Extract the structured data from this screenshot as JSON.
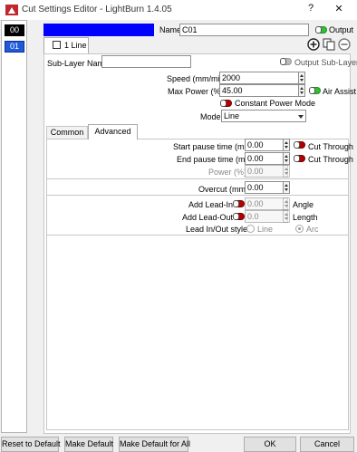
{
  "window": {
    "title": "Cut Settings Editor - LightBurn 1.4.05",
    "help_glyph": "?",
    "close_glyph": "✕"
  },
  "layers": [
    "00",
    "01"
  ],
  "layer_colors": {
    "00": "#000000",
    "01": "#1f59d6",
    "swatch": "#0000ff"
  },
  "header": {
    "name_label": "Name",
    "name_value": "C01",
    "output_label": "Output"
  },
  "sublayer": {
    "tab_label": "1 Line",
    "name_label": "Sub-Layer Name",
    "name_value": "",
    "output_label": "Output Sub-Layer",
    "icons": [
      "add-circle-icon",
      "copy-icon",
      "remove-circle-icon"
    ]
  },
  "settings": {
    "speed_label": "Speed (mm/min)",
    "speed_value": "2000",
    "max_power_label": "Max Power (%)",
    "max_power_value": "45.00",
    "air_assist_label": "Air Assist",
    "constant_power_label": "Constant Power Mode",
    "mode_label": "Mode",
    "mode_value": "Line"
  },
  "tabs": {
    "common": "Common",
    "advanced": "Advanced"
  },
  "advanced": {
    "start_pause_label": "Start pause time (ms)",
    "start_pause_value": "0.00",
    "start_cut_through": "Cut Through",
    "end_pause_label": "End pause time (ms)",
    "end_pause_value": "0.00",
    "end_cut_through": "Cut Through",
    "power_label": "Power (%)",
    "power_value": "0.00",
    "overcut_label": "Overcut (mm)",
    "overcut_value": "0.00",
    "lead_in_label": "Add Lead-In",
    "lead_in_value": "0.00",
    "angle_label": "Angle",
    "lead_out_label": "Add Lead-Out",
    "lead_out_value": "0.0",
    "length_label": "Length",
    "style_label": "Lead In/Out style",
    "style_line": "Line",
    "style_arc": "Arc"
  },
  "buttons": {
    "reset_default": "Reset to Default",
    "make_default": "Make Default",
    "make_default_all": "Make Default for All",
    "ok": "OK",
    "cancel": "Cancel"
  },
  "colors": {
    "output_on": "#30c030",
    "toggle_red": "#b00000",
    "selected_layer": "#1f59d6"
  }
}
